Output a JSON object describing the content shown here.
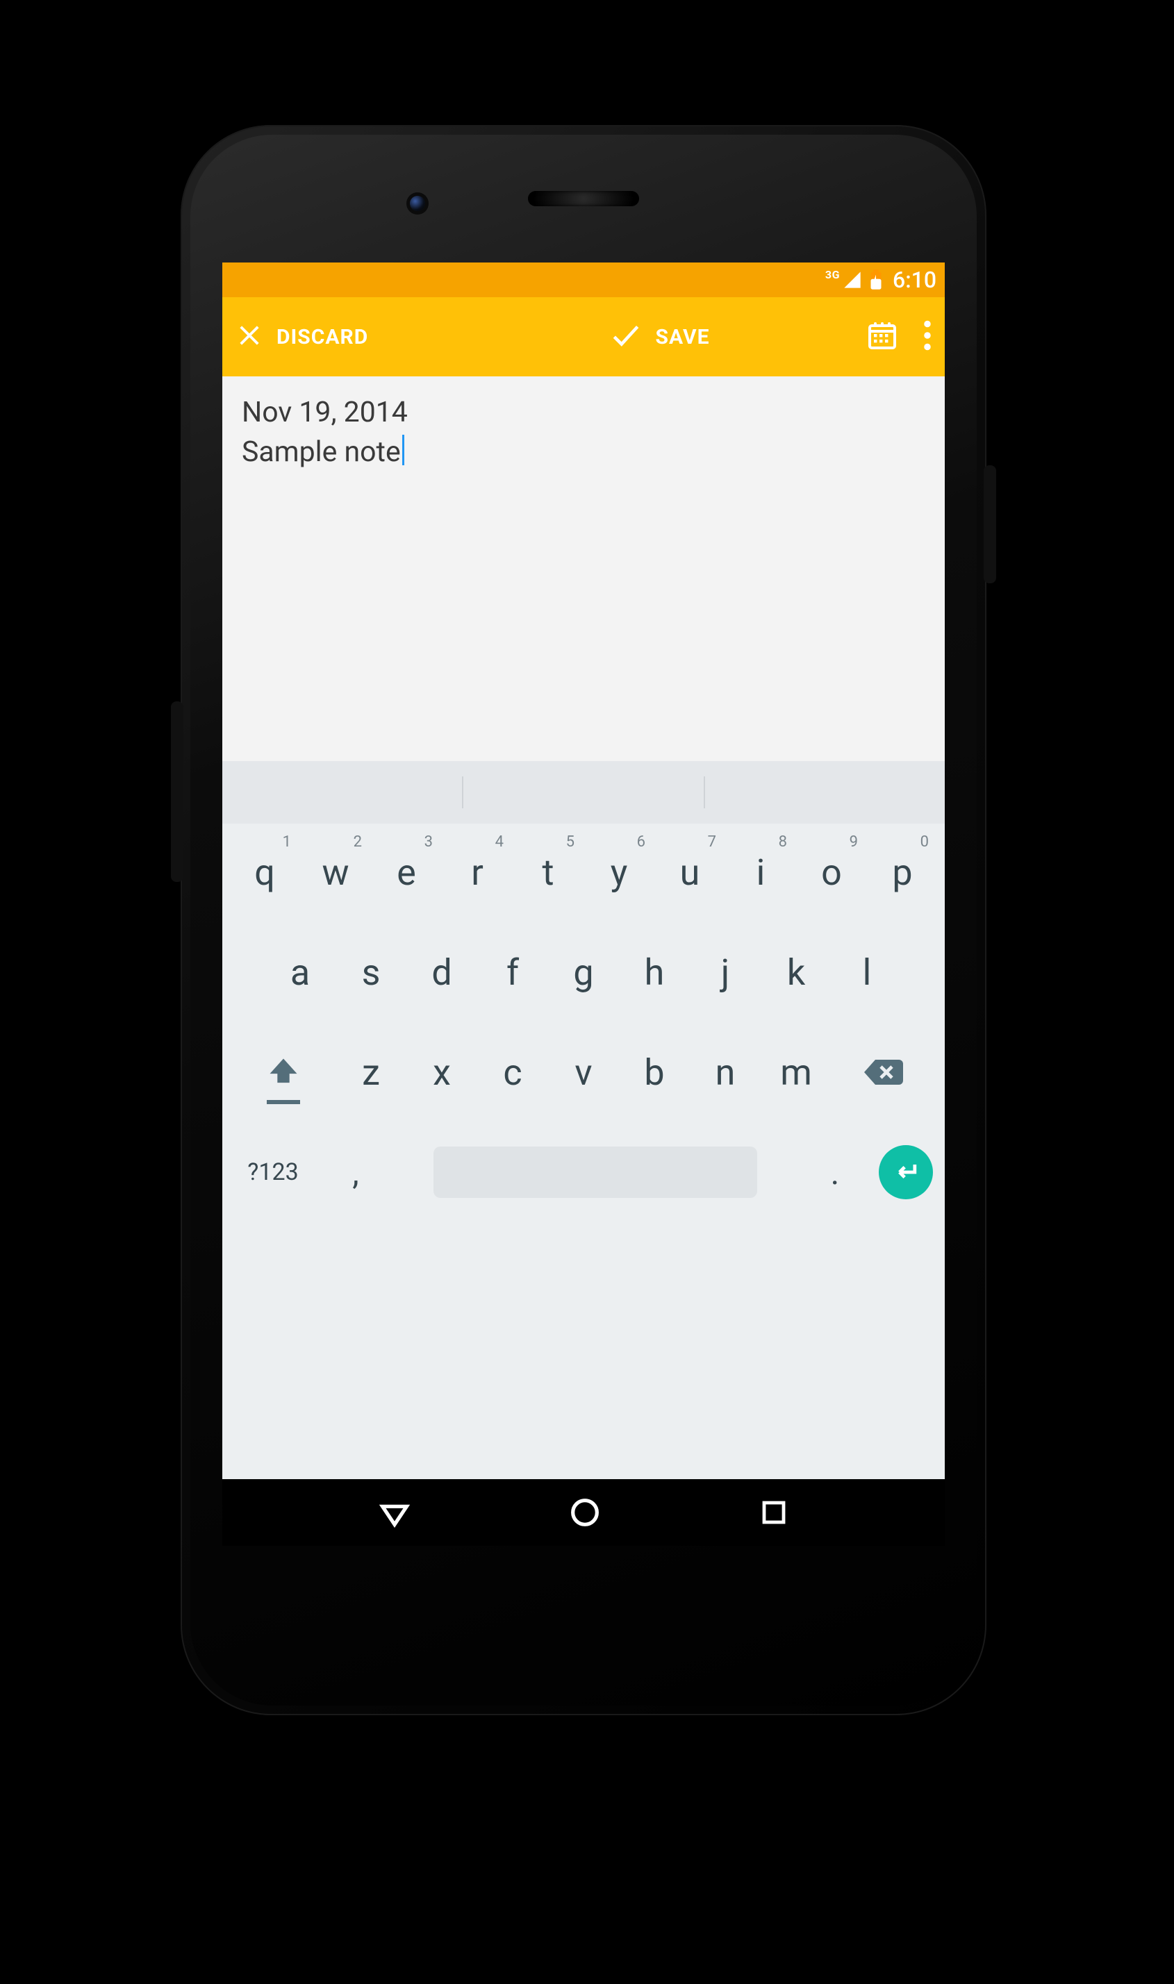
{
  "status": {
    "network": "3G",
    "time": "6:10"
  },
  "actionbar": {
    "discard_label": "DISCARD",
    "save_label": "SAVE"
  },
  "note": {
    "date": "Nov 19, 2014",
    "body": "Sample note"
  },
  "keyboard": {
    "row1": [
      {
        "k": "q",
        "h": "1"
      },
      {
        "k": "w",
        "h": "2"
      },
      {
        "k": "e",
        "h": "3"
      },
      {
        "k": "r",
        "h": "4"
      },
      {
        "k": "t",
        "h": "5"
      },
      {
        "k": "y",
        "h": "6"
      },
      {
        "k": "u",
        "h": "7"
      },
      {
        "k": "i",
        "h": "8"
      },
      {
        "k": "o",
        "h": "9"
      },
      {
        "k": "p",
        "h": "0"
      }
    ],
    "row2": [
      {
        "k": "a"
      },
      {
        "k": "s"
      },
      {
        "k": "d"
      },
      {
        "k": "f"
      },
      {
        "k": "g"
      },
      {
        "k": "h"
      },
      {
        "k": "j"
      },
      {
        "k": "k"
      },
      {
        "k": "l"
      }
    ],
    "row3": [
      {
        "k": "z"
      },
      {
        "k": "x"
      },
      {
        "k": "c"
      },
      {
        "k": "v"
      },
      {
        "k": "b"
      },
      {
        "k": "n"
      },
      {
        "k": "m"
      }
    ],
    "sym": "?123",
    "comma": ",",
    "period": "."
  }
}
